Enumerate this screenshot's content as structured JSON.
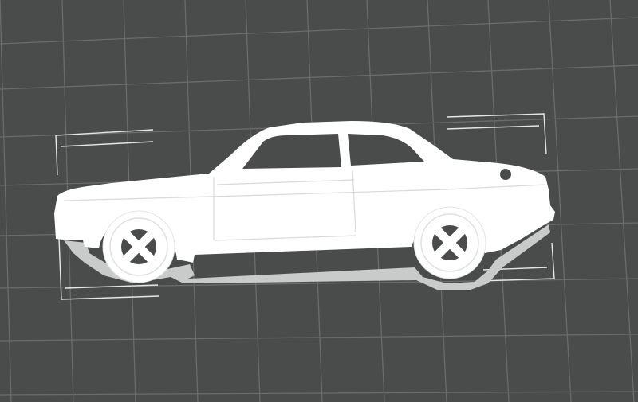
{
  "viewport": {
    "background": "#4a4c4b",
    "grid_color": "#6a6c6b",
    "model_color": "#ffffff",
    "shadow_color": "#c9cbca",
    "window_color": "#4a4c4b",
    "guide_color": "#e6e6e6"
  },
  "model": {
    "subject": "two-door-coupe-silhouette",
    "icons": [
      "car-body-icon",
      "front-wheel-icon",
      "rear-wheel-icon",
      "fuel-cap-icon"
    ]
  }
}
